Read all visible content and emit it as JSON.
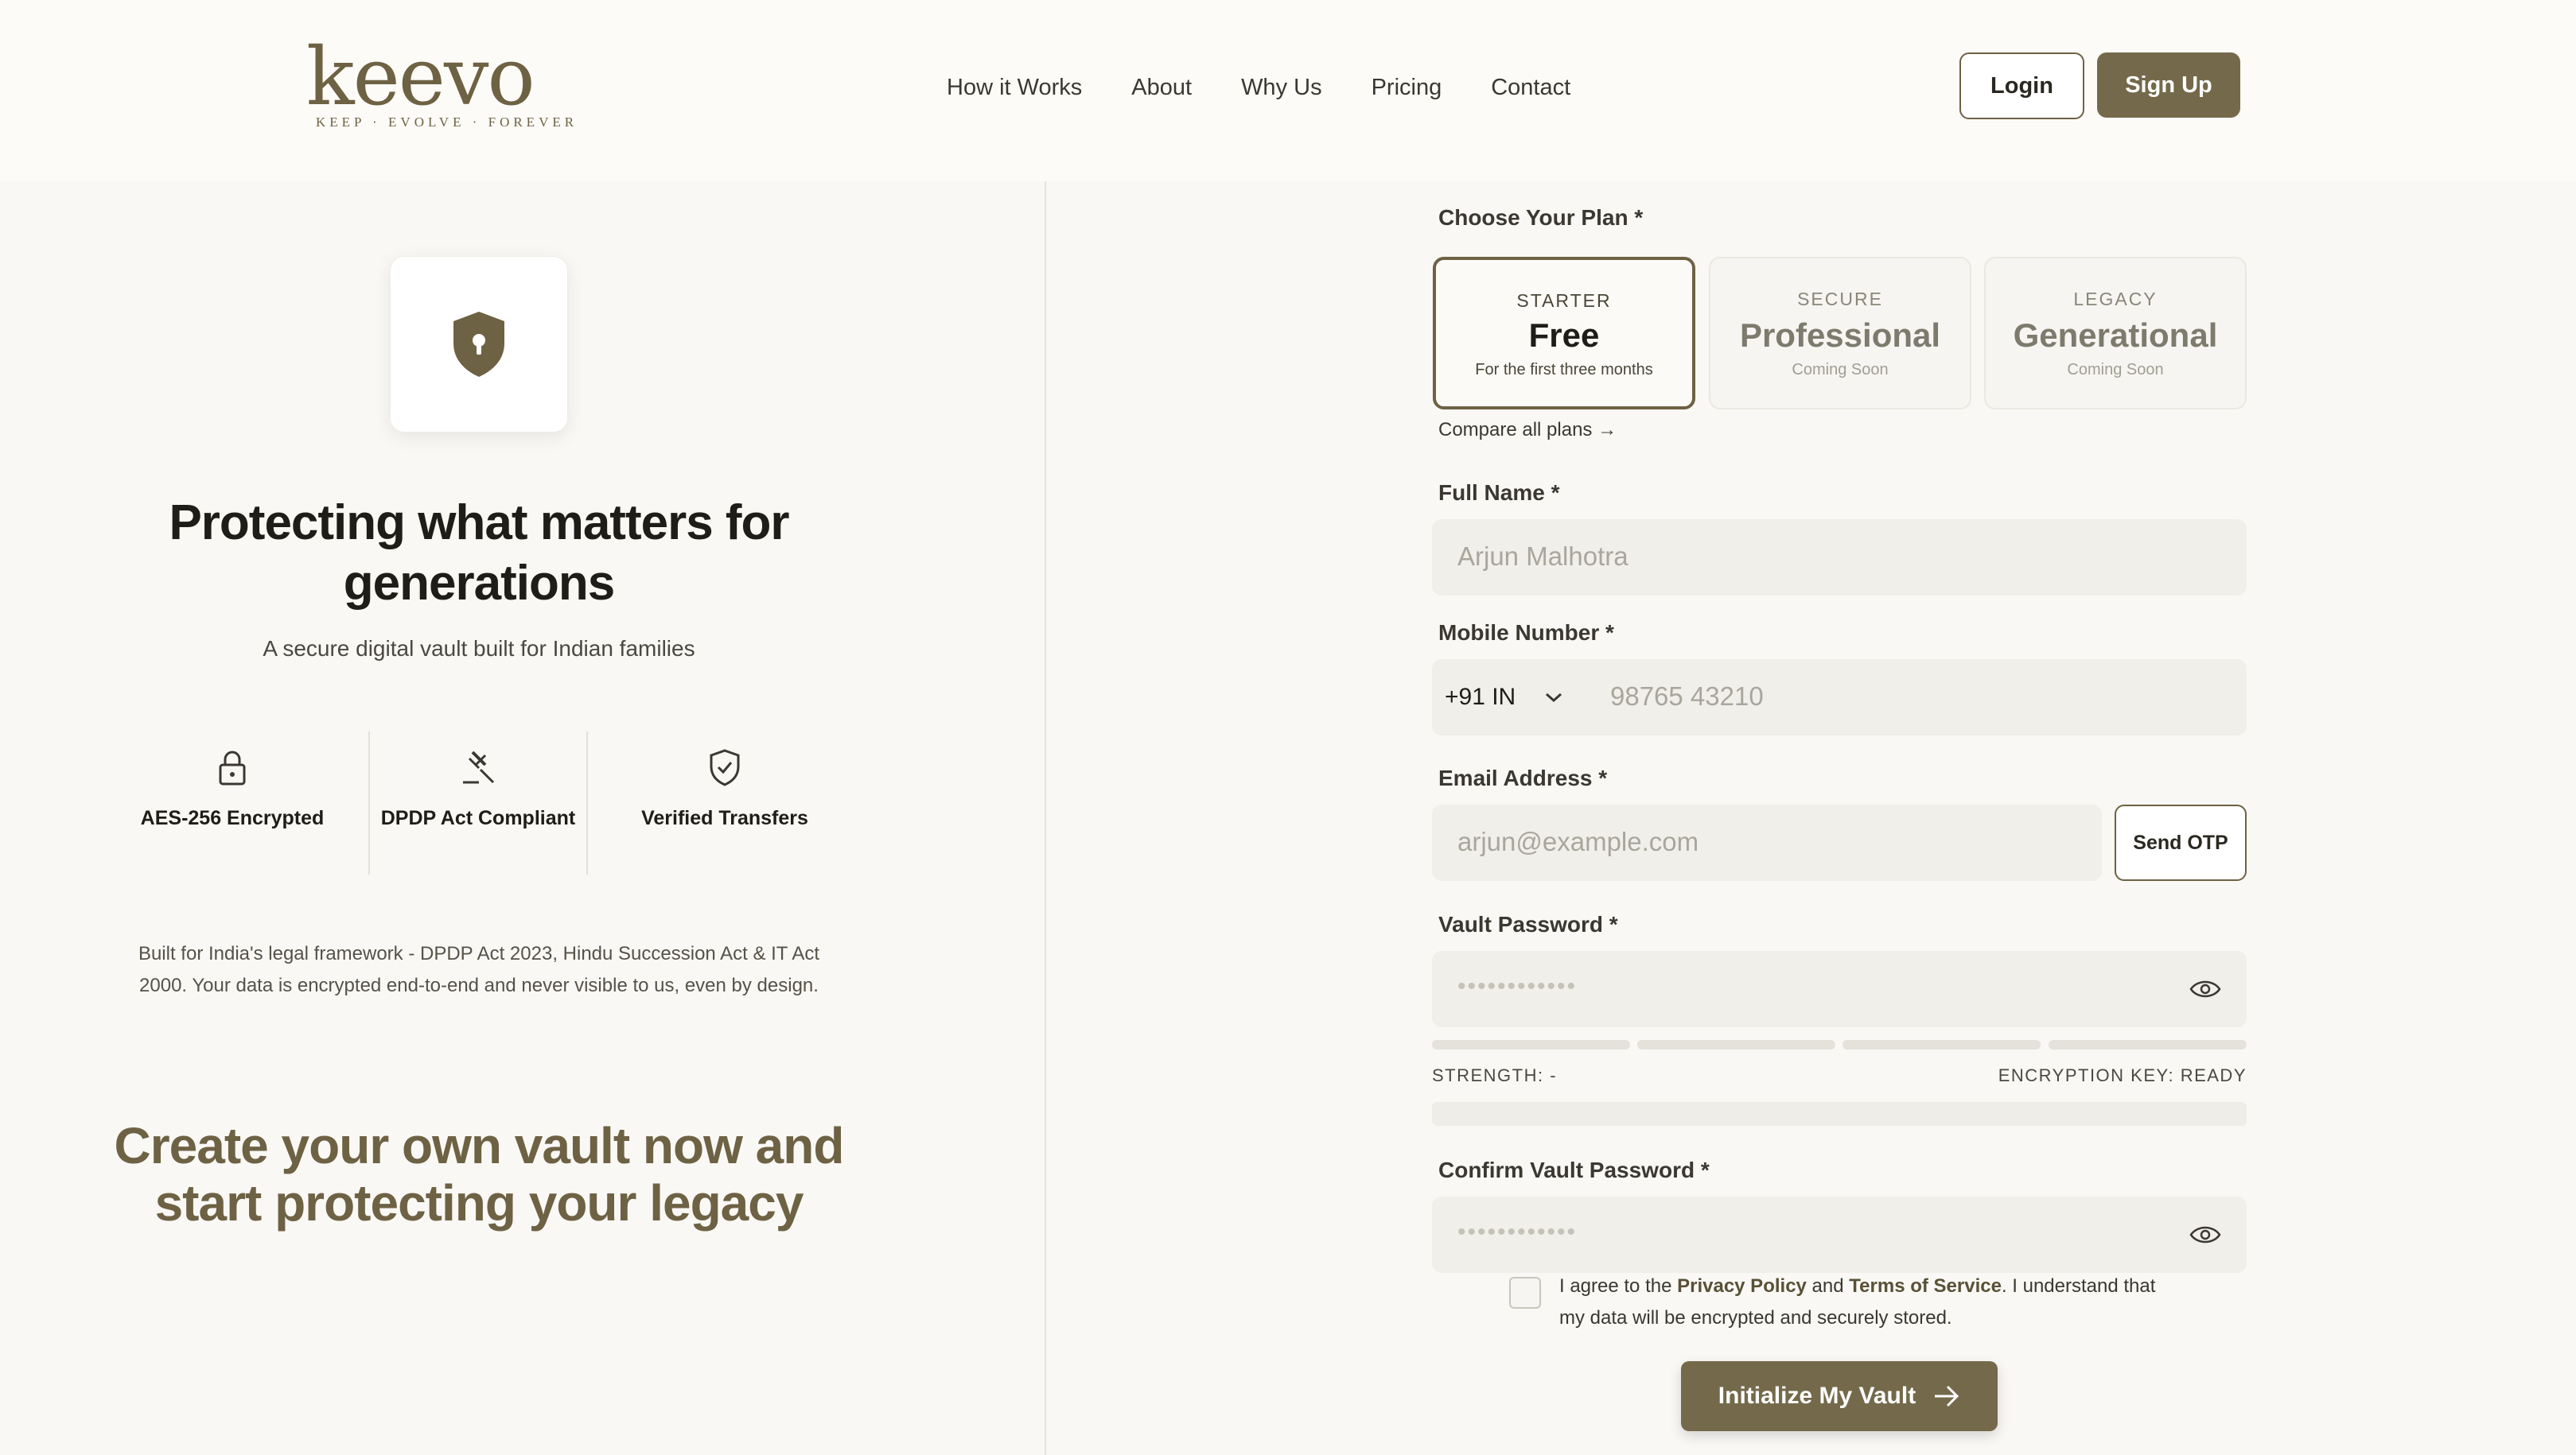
{
  "brand": {
    "logo_text": "keevo",
    "tagline": "KEEP · EVOLVE · FOREVER"
  },
  "nav": {
    "items": [
      "How it Works",
      "About",
      "Why Us",
      "Pricing",
      "Contact"
    ]
  },
  "auth": {
    "login": "Login",
    "signup": "Sign Up"
  },
  "hero": {
    "headline": "Protecting what matters for generations",
    "subline": "A secure digital vault built for Indian families",
    "features": [
      {
        "icon": "padlock-icon",
        "label": "AES-256 Encrypted"
      },
      {
        "icon": "gavel-icon",
        "label": "DPDP Act Compliant"
      },
      {
        "icon": "shield-check-icon",
        "label": "Verified Transfers"
      }
    ],
    "legal": "Built for India's legal framework - DPDP Act 2023, Hindu Succession Act & IT Act 2000. Your data is encrypted end-to-end and never visible to us, even by design.",
    "cta": "Create your own vault now and start protecting your legacy"
  },
  "form": {
    "plan_label": "Choose Your Plan *",
    "plans": [
      {
        "tier": "STARTER",
        "name": "Free",
        "sub": "For the first three months",
        "selected": true
      },
      {
        "tier": "SECURE",
        "name": "Professional",
        "sub": "Coming Soon",
        "selected": false
      },
      {
        "tier": "LEGACY",
        "name": "Generational",
        "sub": "Coming Soon",
        "selected": false
      }
    ],
    "compare_link": "Compare all plans →",
    "full_name": {
      "label": "Full Name *",
      "placeholder": "Arjun Malhotra"
    },
    "mobile": {
      "label": "Mobile Number *",
      "country": "+91 IN",
      "placeholder": "98765 43210"
    },
    "email": {
      "label": "Email Address *",
      "placeholder": "arjun@example.com",
      "otp_button": "Send OTP"
    },
    "password": {
      "label": "Vault Password *",
      "masked": "••••••••••••",
      "strength": "STRENGTH: -",
      "encryption": "ENCRYPTION KEY: READY"
    },
    "confirm_password": {
      "label": "Confirm Vault Password *",
      "masked": "••••••••••••"
    },
    "agree": {
      "pre": "I agree to the ",
      "privacy": "Privacy Policy",
      "and": " and ",
      "terms": "Terms of Service",
      "post": ". I understand that my data will be encrypted and securely stored."
    },
    "submit": "Initialize My Vault"
  },
  "colors": {
    "accent": "#74694a",
    "background": "#f9f8f5",
    "input": "#f1efea"
  }
}
